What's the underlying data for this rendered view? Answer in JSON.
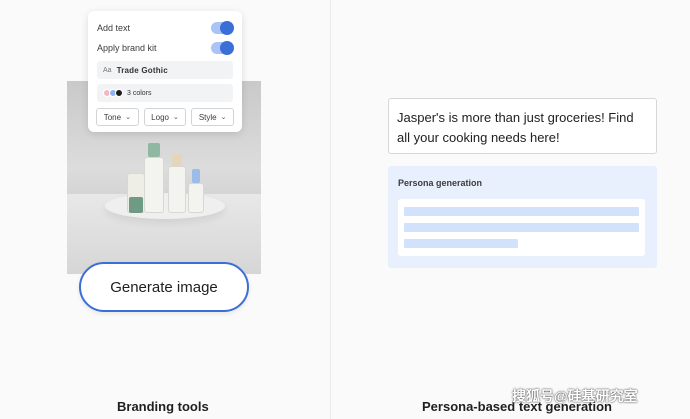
{
  "left_panel": {
    "card": {
      "add_text_label": "Add text",
      "apply_brand_kit_label": "Apply brand kit",
      "font_prefix": "Aa",
      "font_name": "Trade Gothic",
      "colors_label": "3 colors",
      "swatch_colors": [
        "#f4b8c4",
        "#8fb3f0",
        "#1c1c1c"
      ],
      "dropdowns": [
        "Tone",
        "Logo",
        "Style"
      ],
      "toggles": {
        "add_text": true,
        "apply_brand_kit": true
      }
    },
    "generate_button_label": "Generate image",
    "caption": "Branding tools"
  },
  "right_panel": {
    "generated_text": "Jasper's is more than just groceries! Find all your cooking needs here!",
    "persona_title": "Persona generation",
    "caption": "Persona-based text generation"
  },
  "watermark": "搜狐号@硅基研究室",
  "colors": {
    "accent": "#3b6fd8",
    "persona_bg": "#e8f0fe"
  }
}
